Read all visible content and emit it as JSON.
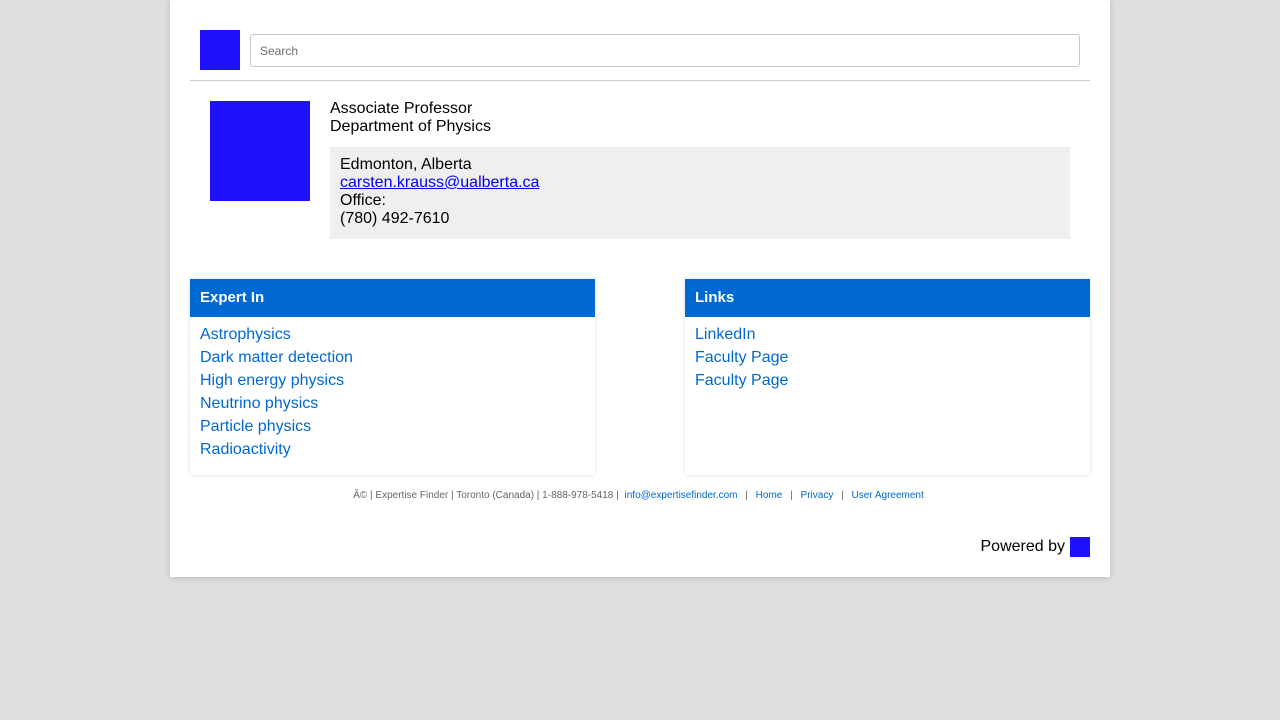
{
  "header": {
    "search_placeholder": "Search"
  },
  "profile": {
    "title": "Associate Professor",
    "department": "Department of Physics",
    "location": "Edmonton, Alberta",
    "email": "carsten.krauss@ualberta.ca",
    "office_label": "Office:",
    "phone": "(780) 492-7610"
  },
  "expert": {
    "heading": "Expert In",
    "items": [
      "Astrophysics",
      "Dark matter detection",
      "High energy physics",
      "Neutrino physics",
      "Particle physics",
      "Radioactivity"
    ]
  },
  "links": {
    "heading": "Links",
    "items": [
      "LinkedIn",
      "Faculty Page",
      "Faculty Page"
    ]
  },
  "footer": {
    "text": "Â© | Expertise Finder | Toronto (Canada) | 1-888-978-5418 |",
    "email": "info@expertisefinder.com",
    "sep": "|",
    "home": "Home",
    "privacy": "Privacy",
    "agreement": "User Agreement"
  },
  "powered": {
    "label": "Powered by"
  },
  "colors": {
    "logo": "#1f11fa",
    "accent": "#0068d1",
    "background": "#dfdfdf"
  }
}
